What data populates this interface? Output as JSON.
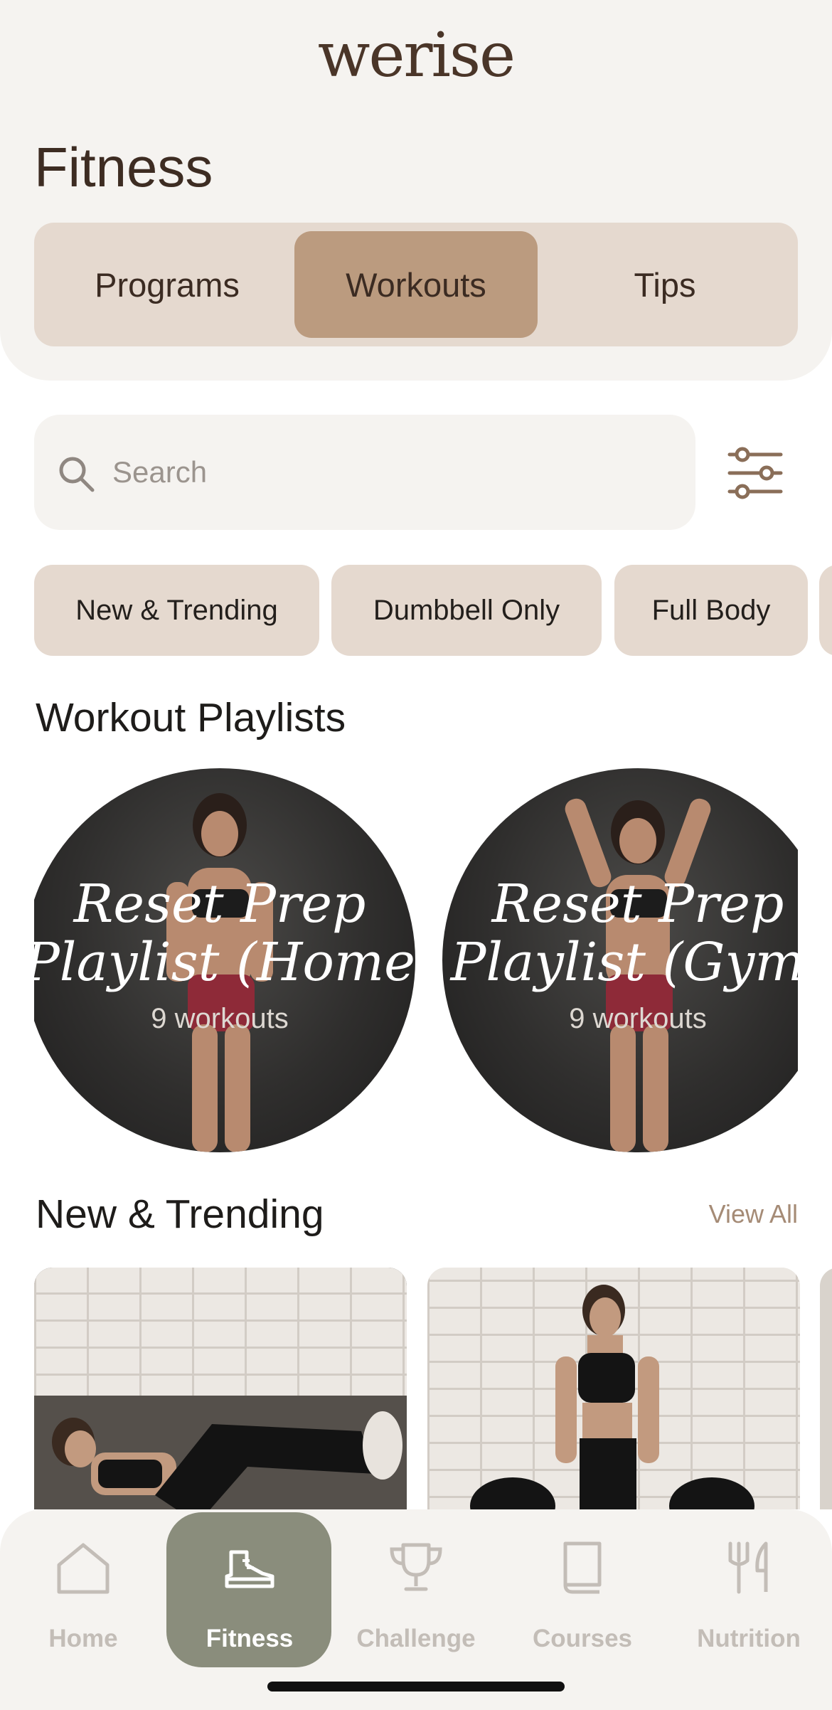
{
  "app": {
    "logo": "werise"
  },
  "header": {
    "title": "Fitness",
    "tabs": [
      {
        "label": "Programs",
        "active": false
      },
      {
        "label": "Workouts",
        "active": true
      },
      {
        "label": "Tips",
        "active": false
      }
    ]
  },
  "search": {
    "placeholder": "Search",
    "value": ""
  },
  "filter": {
    "icon": "sliders-icon"
  },
  "chips": [
    "New & Trending",
    "Dumbbell Only",
    "Full Body"
  ],
  "playlists": {
    "section_title": "Workout Playlists",
    "items": [
      {
        "title_line1": "Reset Prep",
        "title_line2": "Playlist (Home)",
        "count": "9 workouts"
      },
      {
        "title_line1": "Reset Prep",
        "title_line2": "Playlist (Gym)",
        "count": "9 workouts"
      }
    ]
  },
  "trending": {
    "section_title": "New & Trending",
    "view_all": "View All"
  },
  "tabbar": {
    "items": [
      {
        "label": "Home",
        "icon": "home-icon",
        "active": false
      },
      {
        "label": "Fitness",
        "icon": "sneaker-icon",
        "active": true
      },
      {
        "label": "Challenge",
        "icon": "trophy-icon",
        "active": false
      },
      {
        "label": "Courses",
        "icon": "book-icon",
        "active": false
      },
      {
        "label": "Nutrition",
        "icon": "fork-knife-icon",
        "active": false
      }
    ]
  },
  "colors": {
    "accent_tan": "#bb9b7f",
    "segment_bg": "#e5d9cf",
    "tab_active": "#8a8d7c",
    "brown_text": "#3d2c22"
  }
}
